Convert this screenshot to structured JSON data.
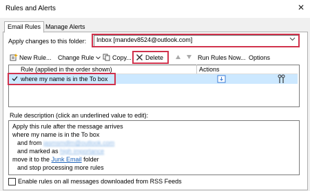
{
  "window": {
    "title": "Rules and Alerts",
    "close_glyph": "✕"
  },
  "tabs": [
    {
      "label": "Email Rules"
    },
    {
      "label": "Manage Alerts"
    }
  ],
  "folder": {
    "label": "Apply changes to this folder:",
    "value": "Inbox [mandev8524@outlook.com]"
  },
  "toolbar": {
    "new_rule": "New Rule...",
    "change_rule": "Change Rule",
    "copy": "Copy...",
    "delete": "Delete",
    "run_rules": "Run Rules Now...",
    "options": "Options"
  },
  "columns": {
    "rule": "Rule (applied in the order shown)",
    "actions": "Actions"
  },
  "rules": [
    {
      "name": "where my name is in the To box",
      "enabled": true
    }
  ],
  "description": {
    "label": "Rule description (click an underlined value to edit):",
    "lines": {
      "l1": "Apply this rule after the message arrives",
      "l2": "where my name is in the To box",
      "l3_prefix": "and from",
      "l3_value": "jasmsmdlm@outlook.com",
      "l4_prefix": "and marked as",
      "l4_value": "high importance",
      "l5_prefix": "move it to the",
      "l5_link": "Junk Email",
      "l5_suffix": "folder",
      "l6": "and stop processing more rules"
    }
  },
  "rss": {
    "label": "Enable rules on all messages downloaded from RSS Feeds",
    "checked": false
  },
  "colors": {
    "highlight": "#d0314b",
    "selection": "#cce8ff",
    "link": "#1c62b9"
  }
}
